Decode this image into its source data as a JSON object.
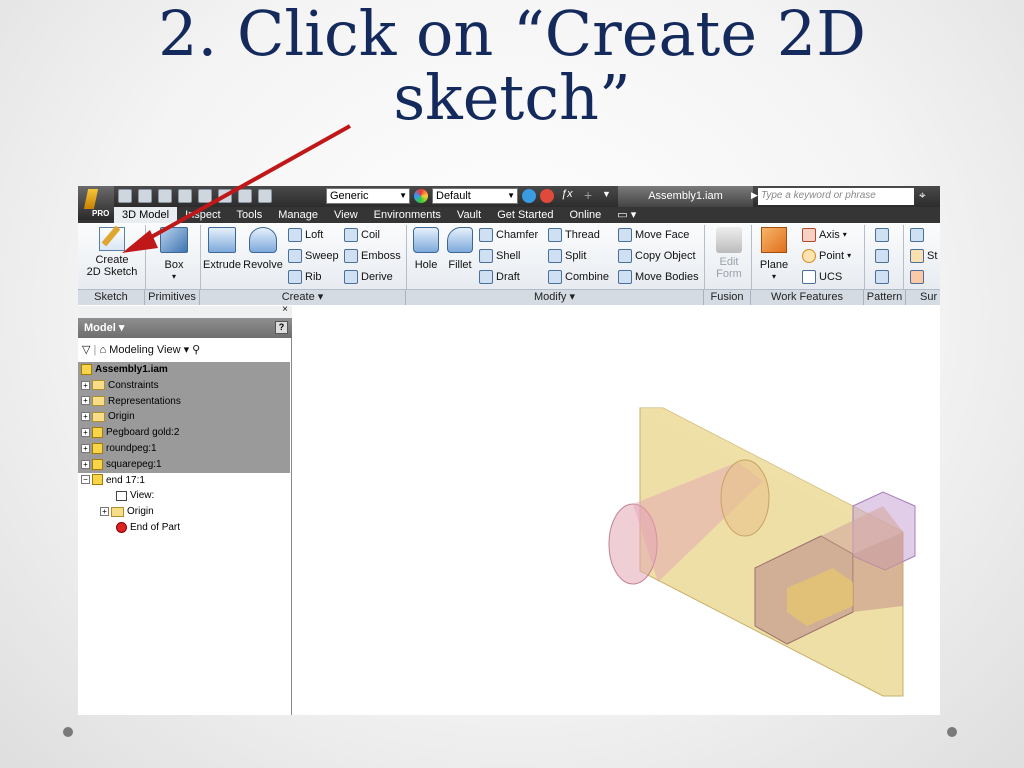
{
  "slide": {
    "title_line1": "2. Click on “Create 2D",
    "title_line2": "sketch”"
  },
  "qat": {
    "pro_label": "PRO",
    "material_combo": "Generic",
    "appearance_combo": "Default",
    "document_title": "Assembly1.iam",
    "search_placeholder": "Type a keyword or phrase"
  },
  "tabs": [
    "3D Model",
    "Inspect",
    "Tools",
    "Manage",
    "View",
    "Environments",
    "Vault",
    "Get Started",
    "Online"
  ],
  "ribbon": {
    "create_2d_sketch": "Create\n2D Sketch",
    "box": "Box",
    "extrude": "Extrude",
    "revolve": "Revolve",
    "loft": "Loft",
    "coil": "Coil",
    "sweep": "Sweep",
    "emboss": "Emboss",
    "rib": "Rib",
    "derive": "Derive",
    "hole": "Hole",
    "fillet": "Fillet",
    "chamfer": "Chamfer",
    "thread": "Thread",
    "move_face": "Move Face",
    "shell": "Shell",
    "split": "Split",
    "copy_object": "Copy Object",
    "draft": "Draft",
    "combine": "Combine",
    "move_bodies": "Move Bodies",
    "edit_form": "Edit\nForm",
    "plane": "Plane",
    "axis": "Axis",
    "point": "Point",
    "ucs": "UCS",
    "st_partial": "St",
    "panels": {
      "sketch": "Sketch",
      "primitives": "Primitives",
      "create": "Create ▾",
      "modify": "Modify ▾",
      "fusion": "Fusion",
      "work_features": "Work Features",
      "pattern": "Pattern",
      "surface_partial": "Sur"
    }
  },
  "browser": {
    "header": "Model ▾",
    "view_combo": "Modeling View",
    "tree": [
      "Assembly1.iam",
      "Constraints",
      "Representations",
      "Origin",
      "Pegboard gold:2",
      "roundpeg:1",
      "squarepeg:1",
      "end 17:1",
      "View:",
      "Origin",
      "End of Part"
    ]
  },
  "colors": {
    "title": "#152a5c",
    "arrow": "#c01818",
    "part_yellow": "#e8d48a",
    "peg_pink": "#e3a6b5",
    "peg_purple": "#c9a4d6"
  }
}
